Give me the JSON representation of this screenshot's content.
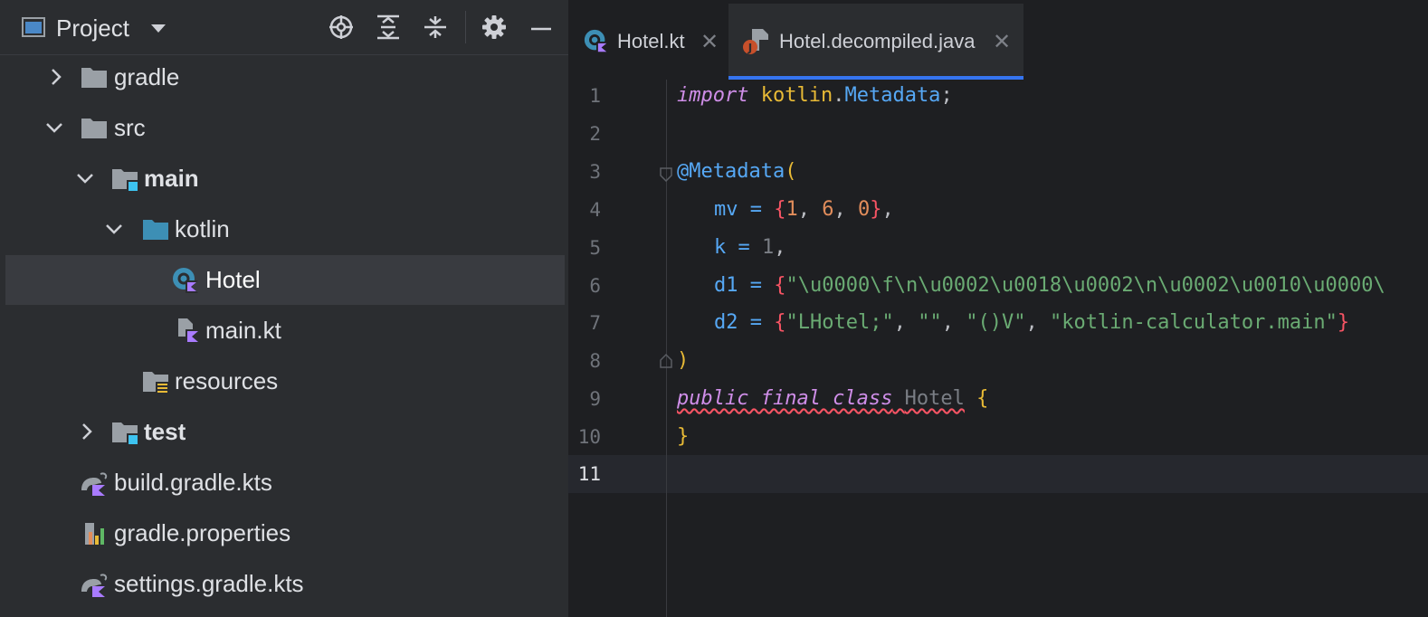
{
  "project_panel": {
    "title": "Project",
    "toolbar": [
      {
        "name": "locate-file-icon"
      },
      {
        "name": "expand-all-icon"
      },
      {
        "name": "collapse-all-icon"
      },
      {
        "name": "gear-icon"
      },
      {
        "name": "minimize-icon"
      }
    ],
    "tree": [
      {
        "label": "gradle",
        "expanded": false,
        "type": "folder"
      },
      {
        "label": "src",
        "expanded": true,
        "type": "folder"
      },
      {
        "label": "main",
        "expanded": true,
        "type": "source-root"
      },
      {
        "label": "kotlin",
        "expanded": true,
        "type": "source-folder"
      },
      {
        "label": "Hotel",
        "type": "kotlin-class",
        "selected": true
      },
      {
        "label": "main.kt",
        "type": "kotlin-file"
      },
      {
        "label": "resources",
        "type": "resources-folder"
      },
      {
        "label": "test",
        "expanded": false,
        "type": "source-root"
      },
      {
        "label": "build.gradle.kts",
        "type": "gradle-script"
      },
      {
        "label": "gradle.properties",
        "type": "properties-file"
      },
      {
        "label": "settings.gradle.kts",
        "type": "gradle-script"
      }
    ]
  },
  "editor": {
    "tabs": [
      {
        "label": "Hotel.kt",
        "active": false,
        "icon": "kotlin-class-icon"
      },
      {
        "label": "Hotel.decompiled.java",
        "active": true,
        "icon": "java-file-icon"
      }
    ],
    "line_numbers": [
      "1",
      "2",
      "3",
      "4",
      "5",
      "6",
      "7",
      "8",
      "9",
      "10",
      "11"
    ],
    "current_line": "11",
    "code": {
      "l1_import": "import",
      "l1_pkg": "kotlin",
      "l1_dot": ".",
      "l1_cls": "Metadata",
      "l1_semi": ";",
      "l3_ann": "@Metadata",
      "l3_paren": "(",
      "l4_field": "mv",
      "l4_eq": " = ",
      "l4_open": "{",
      "l4_v1": "1",
      "l4_c1": ", ",
      "l4_v2": "6",
      "l4_c2": ", ",
      "l4_v3": "0",
      "l4_close": "}",
      "l4_comma": ",",
      "l5_field": "k",
      "l5_eq": " = ",
      "l5_v": "1",
      "l5_comma": ",",
      "l6_field": "d1",
      "l6_eq": " = ",
      "l6_open": "{",
      "l6_str": "\"\\u0000\\f\\n\\u0002\\u0018\\u0002\\n\\u0002\\u0010\\u0000\\",
      "l7_field": "d2",
      "l7_eq": " = ",
      "l7_open": "{",
      "l7_s1": "\"LHotel;\"",
      "l7_c1": ", ",
      "l7_s2": "\"\"",
      "l7_c2": ", ",
      "l7_s3": "\"()V\"",
      "l7_c3": ", ",
      "l7_s4": "\"kotlin-calculator.main\"",
      "l7_close": "}",
      "l8_paren": ")",
      "l9_mods": "public final class",
      "l9_name": "Hotel",
      "l9_brace": "{",
      "l10_brace": "}"
    }
  },
  "colors": {
    "accent": "#3574f0",
    "keyword": "#cf8ee8",
    "annotation": "#56a8f5",
    "string": "#6aab73",
    "number": "#e28d5b",
    "error": "#f75464"
  }
}
